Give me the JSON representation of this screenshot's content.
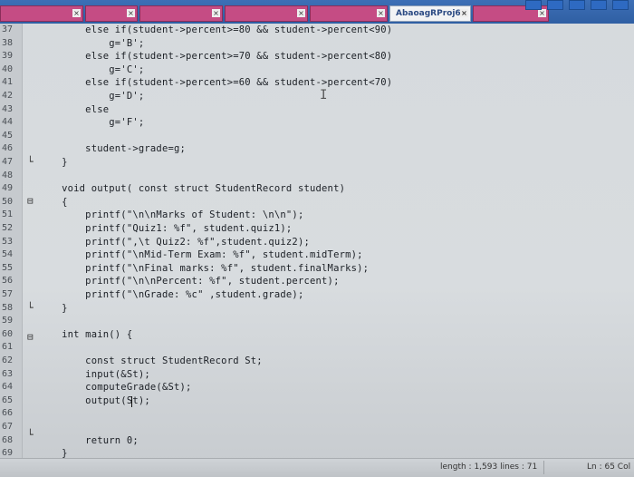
{
  "tabs": [
    {
      "label": "",
      "active": false
    },
    {
      "label": "",
      "active": false
    },
    {
      "label": "",
      "active": false
    },
    {
      "label": "",
      "active": false
    },
    {
      "label": "",
      "active": false
    },
    {
      "label": "AbaoagRProj6.c",
      "active": true
    },
    {
      "label": "",
      "active": false
    }
  ],
  "editor": {
    "lines": [
      {
        "num": "37",
        "text": "        else if(student->percent>=80 && student->percent<90)"
      },
      {
        "num": "38",
        "text": "            g='B';"
      },
      {
        "num": "39",
        "text": "        else if(student->percent>=70 && student->percent<80)"
      },
      {
        "num": "40",
        "text": "            g='C';"
      },
      {
        "num": "41",
        "text": "        else if(student->percent>=60 && student->percent<70)"
      },
      {
        "num": "42",
        "text": "            g='D';"
      },
      {
        "num": "43",
        "text": "        else"
      },
      {
        "num": "44",
        "text": "            g='F';"
      },
      {
        "num": "45",
        "text": ""
      },
      {
        "num": "46",
        "text": "        student->grade=g;"
      },
      {
        "num": "47",
        "text": "    }"
      },
      {
        "num": "48",
        "text": ""
      },
      {
        "num": "49",
        "text": "    void output( const struct StudentRecord student)"
      },
      {
        "num": "50",
        "text": "    {"
      },
      {
        "num": "51",
        "text": "        printf(\"\\n\\nMarks of Student: \\n\\n\");"
      },
      {
        "num": "52",
        "text": "        printf(\"Quiz1: %f\", student.quiz1);"
      },
      {
        "num": "53",
        "text": "        printf(\",\\t Quiz2: %f\",student.quiz2);"
      },
      {
        "num": "54",
        "text": "        printf(\"\\nMid-Term Exam: %f\", student.midTerm);"
      },
      {
        "num": "55",
        "text": "        printf(\"\\nFinal marks: %f\", student.finalMarks);"
      },
      {
        "num": "56",
        "text": "        printf(\"\\n\\nPercent: %f\", student.percent);"
      },
      {
        "num": "57",
        "text": "        printf(\"\\nGrade: %c\" ,student.grade);"
      },
      {
        "num": "58",
        "text": "    }"
      },
      {
        "num": "59",
        "text": ""
      },
      {
        "num": "60",
        "text": "    int main() {"
      },
      {
        "num": "61",
        "text": ""
      },
      {
        "num": "62",
        "text": "        const struct StudentRecord St;"
      },
      {
        "num": "63",
        "text": "        input(&St);"
      },
      {
        "num": "64",
        "text": "        computeGrade(&St);"
      },
      {
        "num": "65",
        "text": "        output(St);"
      },
      {
        "num": "66",
        "text": ""
      },
      {
        "num": "67",
        "text": ""
      },
      {
        "num": "68",
        "text": "        return 0;"
      },
      {
        "num": "69",
        "text": "    }"
      }
    ]
  },
  "status": {
    "length": "length : 1,593   lines : 71",
    "position": "Ln : 65   Col"
  }
}
